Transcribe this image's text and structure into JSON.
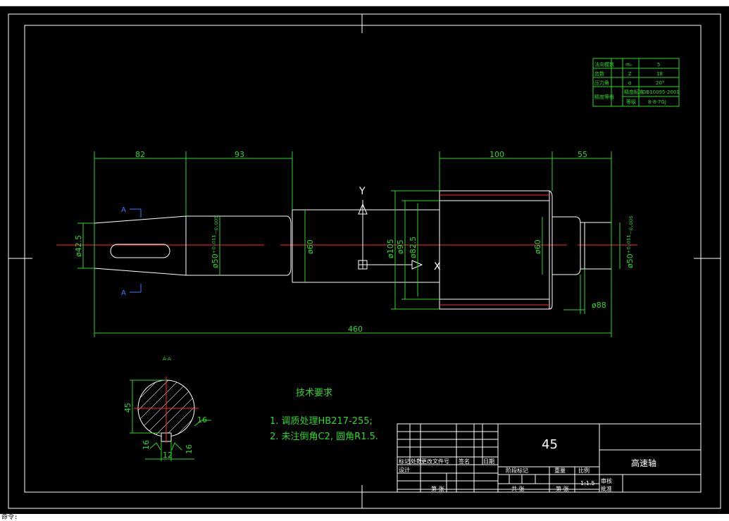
{
  "drawing": {
    "material": "45",
    "scale": "1:1.5",
    "part_title": "高速轴",
    "section_label": "A-A"
  },
  "gear_table": {
    "rows": [
      {
        "name": "法向模数",
        "sym": "mₙ",
        "val": "5"
      },
      {
        "name": "齿数",
        "sym": "Z",
        "val": "18"
      },
      {
        "name": "压力角",
        "sym": "α",
        "val": "20°"
      },
      {
        "name": "精度等级",
        "sym": "精度标准",
        "val": "GB10095-2001"
      },
      {
        "name": "",
        "sym": "等级",
        "val": "8-8-7GJ"
      }
    ]
  },
  "dimensions": {
    "d82": "82",
    "d93": "93",
    "d100": "100",
    "d55": "55",
    "d460": "460",
    "dia42": "ø42.5",
    "dia50_left": "ø50⁺⁰·⁰¹¹₋₀.₀₀₅",
    "dia60_left": "ø60",
    "dia105": "ø105",
    "dia95": "ø95",
    "dia82": "ø82.5",
    "dia60_right": "ø60",
    "dia50_right": "ø50⁺⁰·⁰¹¹₋₀.₀₀₅",
    "dia88": "ø88",
    "sec45": "45",
    "sec16a": "16",
    "sec16b": "16",
    "sec16c": "16",
    "sec12": "12"
  },
  "markers": {
    "y_axis": "Y",
    "x_axis": "X",
    "a_top": "A",
    "a_bottom": "A"
  },
  "tech_req": {
    "title": "技术要求",
    "line1": "1. 调质处理HB217-255;",
    "line2": "2. 未注倒角C2, 圆角R1.5."
  },
  "title_block": {
    "c1": "标记",
    "c2": "处数",
    "c3": "更改文件号",
    "c4": "签名",
    "c5": "日期",
    "design": "设计",
    "check": "审核",
    "approve": "批准",
    "stage": "阶段标记",
    "weight": "重量",
    "scale_lbl": "比例",
    "sheet_of": "共  张",
    "sheet": "第  张"
  },
  "command": {
    "text": "命令:"
  },
  "colors": {
    "background": "#000000",
    "line": "#ffffff",
    "dim": "#2bd82b",
    "center": "#ff2a2a",
    "frame": "#ffffff"
  }
}
